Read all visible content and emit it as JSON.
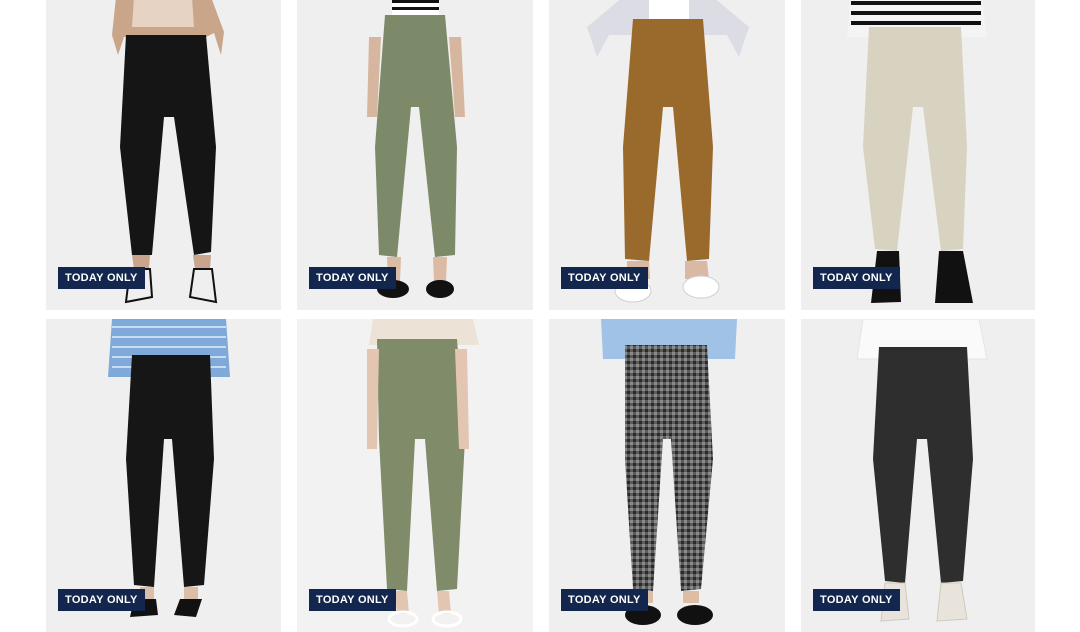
{
  "products": [
    {
      "badge": "TODAY ONLY",
      "pant_color": "#151515",
      "top": "cardigan",
      "shoe": "strappy-sandal"
    },
    {
      "badge": "TODAY ONLY",
      "pant_color": "#7d8a6a",
      "top": "stripe",
      "shoe": "mary-jane"
    },
    {
      "badge": "TODAY ONLY",
      "pant_color": "#9a6a2d",
      "top": "white-shirt",
      "shoe": "white-loafer"
    },
    {
      "badge": "TODAY ONLY",
      "pant_color": "#d8d2c1",
      "top": "stripe",
      "shoe": "black-boot"
    },
    {
      "badge": "TODAY ONLY",
      "pant_color": "#161616",
      "top": "blue-stripe-shirt",
      "shoe": "black-heel"
    },
    {
      "badge": "TODAY ONLY",
      "pant_color": "#7f8b69",
      "top": "cream-knit",
      "shoe": "white-sandal"
    },
    {
      "badge": "TODAY ONLY",
      "pant_color": "#5c5c5c",
      "top": "blue-shirt",
      "shoe": "mary-jane"
    },
    {
      "badge": "TODAY ONLY",
      "pant_color": "#2e2e2e",
      "top": "white-shirt",
      "shoe": "white-sneaker"
    }
  ],
  "colors": {
    "badge_bg": "#13264d",
    "badge_text": "#ffffff",
    "photo_bg": "#f1f1f1"
  }
}
